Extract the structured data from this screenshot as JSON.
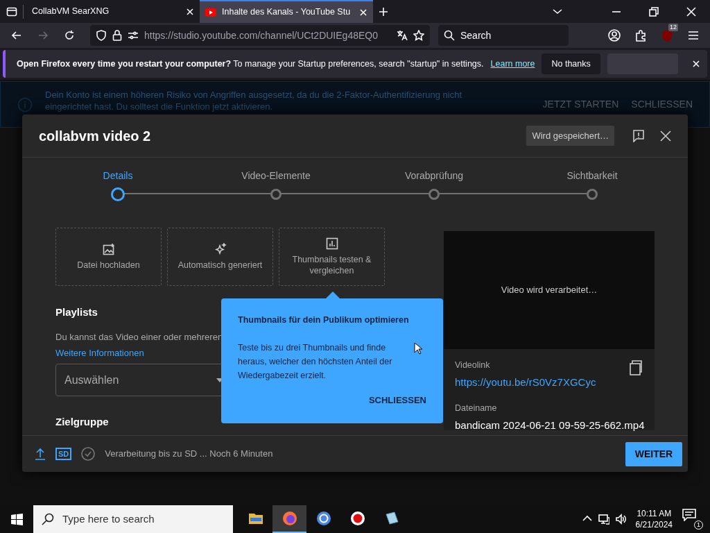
{
  "browser": {
    "tabs": [
      {
        "title": "CollabVM SearXNG",
        "selected": false,
        "kind": "plain"
      },
      {
        "title": "Inhalte des Kanals - YouTube Stu",
        "selected": true,
        "kind": "youtube"
      }
    ],
    "url": "https://studio.youtube.com/channel/UCt2DUIEg48EQ0",
    "search": {
      "placeholder": "Search"
    },
    "extension_badge": "12"
  },
  "notification": {
    "question": "Open Firefox every time you restart your computer?",
    "text": "To manage your Startup preferences, search \"startup\" in settings.",
    "link": "Learn more",
    "button": "No thanks"
  },
  "security_banner": {
    "text": "Dein Konto ist einem höheren Risiko von Angriffen ausgesetzt, da du die 2-Faktor-Authentifizierung nicht eingerichtet hast. Du solltest die Funktion jetzt aktivieren.",
    "actions": [
      "JETZT STARTEN",
      "SCHLIESSEN"
    ]
  },
  "dialog": {
    "title": "collabvm video 2",
    "save_status": "Wird gespeichert…",
    "steps": [
      {
        "label": "Details",
        "selected": true
      },
      {
        "label": "Video-Elemente",
        "selected": false
      },
      {
        "label": "Vorabprüfung",
        "selected": false
      },
      {
        "label": "Sichtbarkeit",
        "selected": false
      }
    ],
    "thumbnail_options": [
      {
        "kind": "upload",
        "label": "Datei hochladen"
      },
      {
        "kind": "auto",
        "label": "Automatisch generiert"
      },
      {
        "kind": "test",
        "label": "Thumbnails testen & vergleichen"
      }
    ],
    "playlists": {
      "heading": "Playlists",
      "text": "Du kannst das Video einer oder mehreren",
      "link": "Weitere Informationen",
      "select_placeholder": "Auswählen"
    },
    "audience": {
      "heading": "Zielgruppe"
    },
    "preview": {
      "status": "Video wird verarbeitet…",
      "link_label": "Videolink",
      "link": "https://youtu.be/rS0Vz7XGCyc",
      "file_label": "Dateiname",
      "file_name": "bandicam 2024-06-21 09-59-25-662.mp4"
    },
    "footer": {
      "quality": "SD",
      "status": "Verarbeitung bis zu SD ... Noch 6 Minuten",
      "next_button": "WEITER"
    },
    "popover": {
      "title": "Thumbnails für dein Publikum optimieren",
      "text": "Teste bis zu drei Thumbnails und finde heraus, welcher den höchsten Anteil der Wiedergabezeit erzielt.",
      "close": "SCHLIESSEN"
    }
  },
  "taskbar": {
    "search_placeholder": "Type here to search",
    "apps": [
      {
        "kind": "files",
        "selected": false
      },
      {
        "kind": "firefox",
        "selected": true
      },
      {
        "kind": "chrome",
        "selected": false
      },
      {
        "kind": "recorder",
        "selected": false
      },
      {
        "kind": "notepad",
        "selected": false
      }
    ],
    "time": "10:11 AM",
    "date": "6/21/2024",
    "notifications": "1"
  }
}
